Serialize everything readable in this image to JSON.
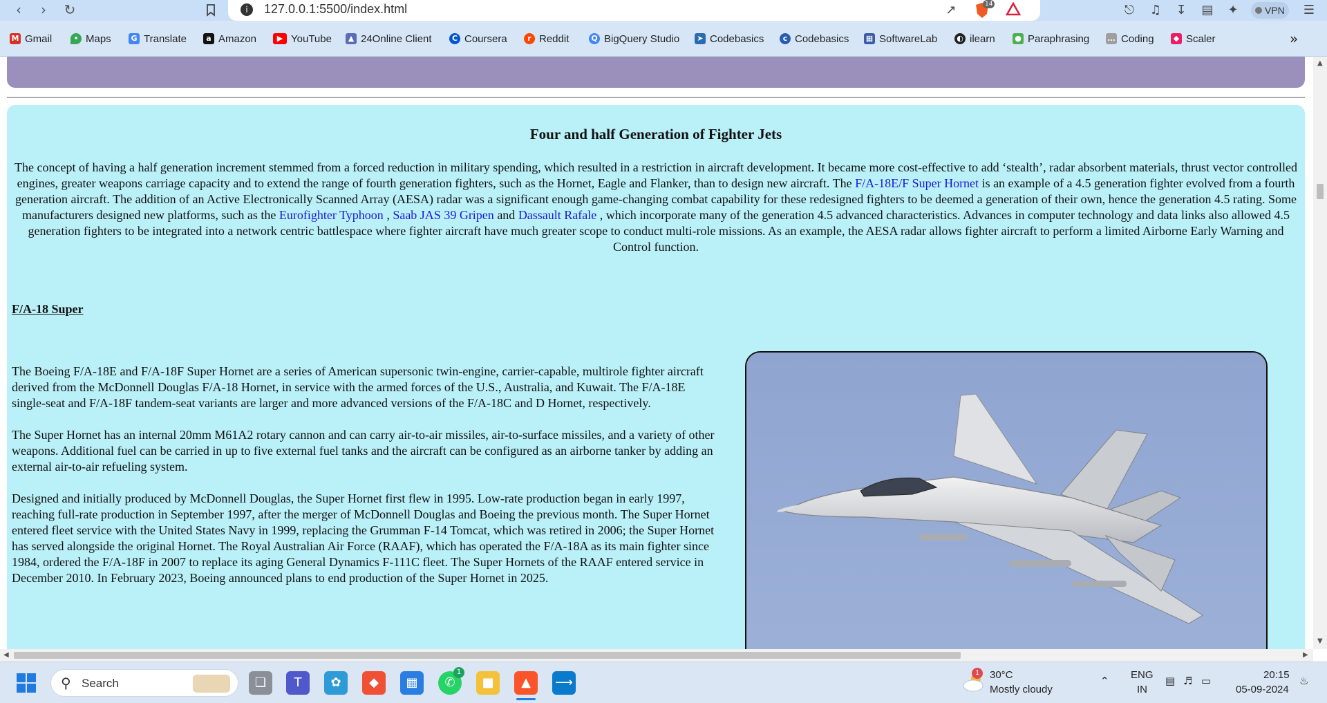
{
  "browser": {
    "url": "127.0.0.1:5500/index.html",
    "vpn_label": "VPN",
    "brave_badge": "14"
  },
  "bookmarks": [
    {
      "label": "Gmail",
      "icon": "gmail-icon",
      "color": "#d93025"
    },
    {
      "label": "Maps",
      "icon": "maps-icon",
      "color": "#34a853"
    },
    {
      "label": "Translate",
      "icon": "translate-icon",
      "color": "#4285f4"
    },
    {
      "label": "Amazon",
      "icon": "amazon-icon",
      "color": "#111111"
    },
    {
      "label": "YouTube",
      "icon": "youtube-icon",
      "color": "#ff0000"
    },
    {
      "label": "24Online Client",
      "icon": "24online-icon",
      "color": "#5b6bb5"
    },
    {
      "label": "Coursera",
      "icon": "coursera-icon",
      "color": "#0056d2"
    },
    {
      "label": "Reddit",
      "icon": "reddit-icon",
      "color": "#ff4500"
    },
    {
      "label": "BigQuery Studio",
      "icon": "bigquery-icon",
      "color": "#4285f4"
    },
    {
      "label": "Codebasics",
      "icon": "codebasics-rocket-icon",
      "color": "#2b6cb0"
    },
    {
      "label": "Codebasics",
      "icon": "codebasics-icon",
      "color": "#2a5db0"
    },
    {
      "label": "SoftwareLab",
      "icon": "softwarelab-icon",
      "color": "#3b5ba5"
    },
    {
      "label": "ilearn",
      "icon": "ilearn-icon",
      "color": "#222222"
    },
    {
      "label": "Paraphrasing",
      "icon": "paraphrasing-icon",
      "color": "#4caf50"
    },
    {
      "label": "Coding",
      "icon": "coding-icon",
      "color": "#9e9e9e"
    },
    {
      "label": "Scaler",
      "icon": "scaler-icon",
      "color": "#e91e63"
    }
  ],
  "page": {
    "section_title": "Four and half Generation of Fighter Jets",
    "intro": {
      "t1": "The concept of having a half generation increment stemmed from a forced reduction in military spending, which resulted in a restriction in aircraft development. It became more cost-effective to add ‘stealth’, radar absorbent materials, thrust vector controlled engines, greater weapons carriage capacity and to extend the range of fourth generation fighters, such as the Hornet, Eagle and Flanker, than to design new aircraft. The ",
      "link1": "F/A-18E/F Super Hornet",
      "t2": " is an example of a 4.5 generation fighter evolved from a fourth generation aircraft. The addition of an Active Electronically Scanned Array (AESA) radar was a significant enough game-changing combat capability for these redesigned fighters to be deemed a generation of their own, hence the generation 4.5 rating. Some manufacturers designed new platforms, such as the ",
      "link2": "Eurofighter Typhoon",
      "sep1": " , ",
      "link3": "Saab JAS 39 Gripen",
      "sep2": " and ",
      "link4": "Dassault Rafale",
      "t3": " , which incorporate many of the generation 4.5 advanced characteristics. Advances in computer technology and data links also allowed 4.5 generation fighters to be integrated into a network centric battlespace where fighter aircraft have much greater scope to conduct multi-role missions. As an example, the AESA radar allows fighter aircraft to perform a limited Airborne Early Warning and Control function."
    },
    "sub_heading": "F/A-18 Super",
    "paragraphs": [
      "The Boeing F/A-18E and F/A-18F Super Hornet are a series of American supersonic twin-engine, carrier-capable, multirole fighter aircraft derived from the McDonnell Douglas F/A-18 Hornet, in service with the armed forces of the U.S., Australia, and Kuwait. The F/A-18E single-seat and F/A-18F tandem-seat variants are larger and more advanced versions of the F/A-18C and D Hornet, respectively.",
      "The Super Hornet has an internal 20mm M61A2 rotary cannon and can carry air-to-air missiles, air-to-surface missiles, and a variety of other weapons. Additional fuel can be carried in up to five external fuel tanks and the aircraft can be configured as an airborne tanker by adding an external air-to-air refueling system.",
      "Designed and initially produced by McDonnell Douglas, the Super Hornet first flew in 1995. Low-rate production began in early 1997, reaching full-rate production in September 1997, after the merger of McDonnell Douglas and Boeing the previous month. The Super Hornet entered fleet service with the United States Navy in 1999, replacing the Grumman F-14 Tomcat, which was retired in 2006; the Super Hornet has served alongside the original Hornet. The Royal Australian Air Force (RAAF), which has operated the F/A-18A as its main fighter since 1984, ordered the F/A-18F in 2007 to replace its aging General Dynamics F-111C fleet. The Super Hornets of the RAAF entered service in December 2010. In February 2023, Boeing announced plans to end production of the Super Hornet in 2025."
    ]
  },
  "taskbar": {
    "search_label": "Search",
    "whatsapp_badge": "1",
    "weather_badge": "1",
    "temperature": "30°C",
    "weather_desc": "Mostly cloudy",
    "lang_top": "ENG",
    "lang_bottom": "IN",
    "time": "20:15",
    "date": "05-09-2024"
  },
  "colors": {
    "content_bg": "#baf0f8",
    "purple_band": "#9b8fbb",
    "link": "#1a1adb"
  }
}
